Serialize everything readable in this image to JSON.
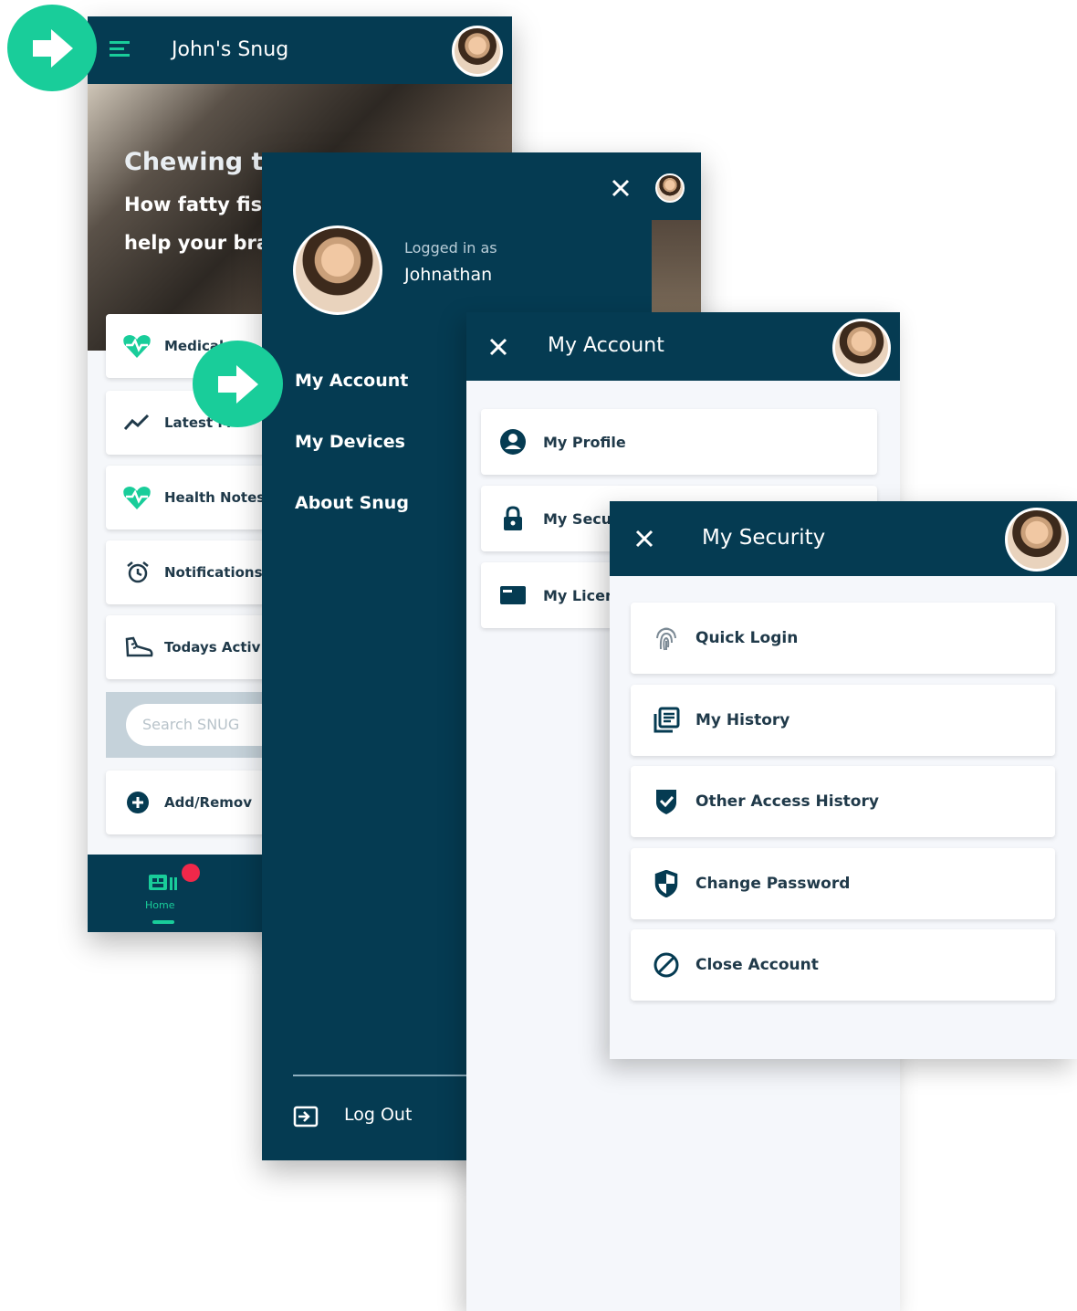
{
  "colors": {
    "navy": "#053b52",
    "accent": "#19cd9a",
    "badge": "#f0284a",
    "page_bg": "#f5f7fb"
  },
  "home": {
    "title": "John's Snug",
    "hero": {
      "line1": "Chewing t",
      "line2": "How fatty fis",
      "line3": "help your bra"
    },
    "cards": [
      {
        "label": "Medical",
        "icon": "heart-monitor-icon"
      },
      {
        "label": "Latest M",
        "icon": "trend-line-icon"
      },
      {
        "label": "Health Notes",
        "icon": "heart-monitor-icon"
      },
      {
        "label": "Notifications",
        "icon": "alarm-clock-icon"
      },
      {
        "label": "Todays Activ",
        "icon": "running-shoe-icon"
      }
    ],
    "search_placeholder": "Search SNUG",
    "add_remove": "Add/Remov",
    "bottom_nav": {
      "home_label": "Home"
    }
  },
  "drawer": {
    "logged_in_as": "Logged in as",
    "username": "Johnathan",
    "menu": [
      "My Account",
      "My Devices",
      "About Snug"
    ],
    "logout": "Log Out"
  },
  "account": {
    "title": "My Account",
    "items": [
      {
        "label": "My Profile",
        "icon": "user-circle-icon"
      },
      {
        "label": "My Secu",
        "icon": "padlock-icon"
      },
      {
        "label": "My Licen",
        "icon": "license-card-icon"
      }
    ]
  },
  "security": {
    "title": "My Security",
    "items": [
      {
        "label": "Quick Login",
        "icon": "fingerprint-icon"
      },
      {
        "label": "My History",
        "icon": "history-list-icon"
      },
      {
        "label": "Other Access History",
        "icon": "shield-check-icon"
      },
      {
        "label": "Change Password",
        "icon": "shield-half-icon"
      },
      {
        "label": "Close Account",
        "icon": "block-icon"
      }
    ]
  }
}
